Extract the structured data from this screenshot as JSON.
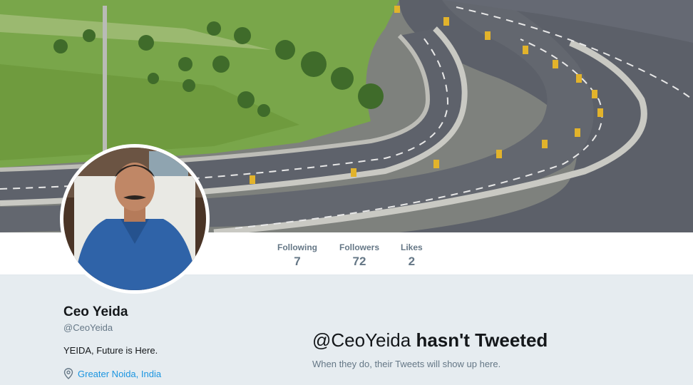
{
  "profile": {
    "name": "Ceo Yeida",
    "handle": "@CeoYeida",
    "bio": "YEIDA, Future is Here.",
    "location": "Greater Noida, India"
  },
  "stats": [
    {
      "label": "Following",
      "value": "7"
    },
    {
      "label": "Followers",
      "value": "72"
    },
    {
      "label": "Likes",
      "value": "2"
    }
  ],
  "empty_state": {
    "handle": "@CeoYeida",
    "title_rest": "hasn't Tweeted",
    "subtitle": "When they do, their Tweets will show up here."
  },
  "icons": {
    "location": "location-pin-icon"
  },
  "colors": {
    "link": "#1b95e0",
    "muted": "#657786",
    "text": "#14171a",
    "page_bg": "#e6ecf0"
  }
}
